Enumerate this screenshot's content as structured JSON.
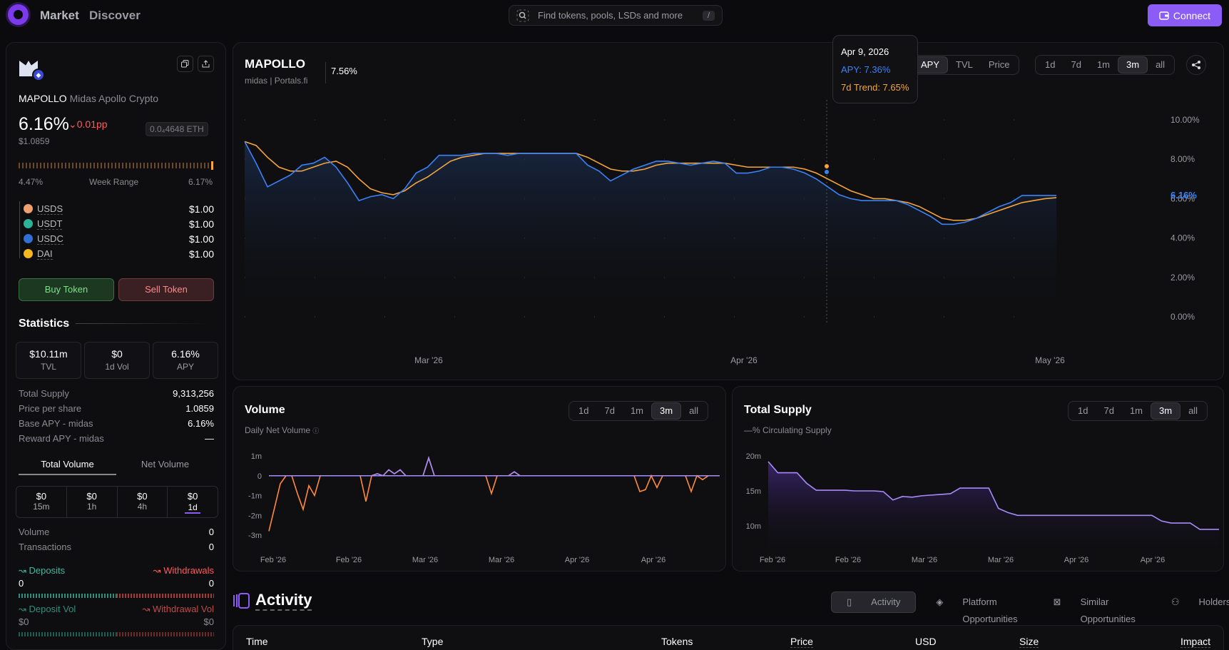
{
  "nav": {
    "brand_items": [
      "Market",
      "Discover"
    ],
    "search_placeholder": "Find tokens, pools, LSDs and more",
    "search_shortcut": "/",
    "connect_label": "Connect"
  },
  "token": {
    "symbol": "MAPOLLO",
    "name": "Midas Apollo Crypto",
    "apy": "6.16%",
    "change": "0.01pp",
    "price": "$1.0859",
    "eth_price": "0.0₄4648 ETH",
    "week_low": "4.47%",
    "week_label": "Week Range",
    "week_high": "6.17%",
    "underlyings": [
      {
        "name": "USDS",
        "value": "$1.00",
        "color": "#f0a070"
      },
      {
        "name": "USDT",
        "value": "$1.00",
        "color": "#2bb39a"
      },
      {
        "name": "USDC",
        "value": "$1.00",
        "color": "#2f6fd6"
      },
      {
        "name": "DAI",
        "value": "$1.00",
        "color": "#f5b71f"
      }
    ],
    "buy_label": "Buy Token",
    "sell_label": "Sell Token"
  },
  "stats": {
    "title": "Statistics",
    "cards": [
      {
        "value": "$10.11m",
        "label": "TVL"
      },
      {
        "value": "$0",
        "label": "1d Vol"
      },
      {
        "value": "6.16%",
        "label": "APY"
      }
    ],
    "rows": [
      {
        "label": "Total Supply",
        "value": "9,313,256"
      },
      {
        "label": "Price per share",
        "value": "1.0859"
      },
      {
        "label": "Base APY - midas",
        "value": "6.16%"
      },
      {
        "label": "Reward APY - midas",
        "value": "—"
      }
    ],
    "vol_tabs": [
      "Total Volume",
      "Net Volume"
    ],
    "periods": [
      {
        "value": "$0",
        "label": "15m"
      },
      {
        "value": "$0",
        "label": "1h"
      },
      {
        "value": "$0",
        "label": "4h"
      },
      {
        "value": "$0",
        "label": "1d"
      }
    ],
    "volume_label": "Volume",
    "volume_value": "0",
    "tx_label": "Transactions",
    "tx_value": "0",
    "deposits_label": "Deposits",
    "withdrawals_label": "Withdrawals",
    "deposits_value": "0",
    "withdrawals_value": "0",
    "deposit_vol_label": "Deposit Vol",
    "withdrawal_vol_label": "Withdrawal Vol",
    "deposit_vol_value": "$0",
    "withdrawal_vol_value": "$0"
  },
  "main_chart": {
    "title": "MAPOLLO",
    "subtitle": "midas | Portals.fi",
    "value": "7.56%",
    "metric_tabs": [
      "APY",
      "TVL",
      "Price"
    ],
    "range_tabs": [
      "1d",
      "7d",
      "1m",
      "3m",
      "all"
    ],
    "tooltip": {
      "date": "Apr 9, 2026",
      "apy": "APY: 7.36%",
      "trend": "7d Trend: 7.65%"
    },
    "current_label": "6.16%",
    "colors": {
      "apy": "#3b82f6",
      "trend": "#f5a53a"
    }
  },
  "volume_chart": {
    "title": "Volume",
    "subtitle": "Daily Net Volume",
    "range_tabs": [
      "1d",
      "7d",
      "1m",
      "3m",
      "all"
    ]
  },
  "supply_chart": {
    "title": "Total Supply",
    "subtitle": "—% Circulating Supply",
    "range_tabs": [
      "1d",
      "7d",
      "1m",
      "3m",
      "all"
    ]
  },
  "chart_data": [
    {
      "type": "line",
      "title": "MAPOLLO",
      "x_labels": [
        "Mar '26",
        "Apr '26",
        "May '26"
      ],
      "y_ticks": [
        "10.00%",
        "8.00%",
        "6.00%",
        "4.00%",
        "2.00%",
        "0.00%"
      ],
      "ylim": [
        0,
        10
      ],
      "series": [
        {
          "name": "APY",
          "values": [
            8.9,
            7.8,
            6.6,
            6.9,
            7.2,
            7.7,
            7.8,
            8.1,
            7.6,
            6.8,
            5.9,
            6.1,
            6.2,
            6.0,
            6.5,
            7.3,
            7.6,
            8.2,
            8.2,
            8.2,
            8.3,
            8.3,
            8.3,
            8.2,
            8.3,
            8.3,
            8.3,
            8.3,
            8.3,
            8.3,
            7.7,
            7.4,
            6.9,
            7.2,
            7.5,
            7.7,
            7.9,
            7.9,
            7.8,
            7.7,
            7.8,
            7.9,
            7.8,
            7.3,
            7.3,
            7.4,
            7.6,
            7.6,
            7.5,
            7.3,
            7.0,
            6.6,
            6.2,
            6.0,
            5.9,
            5.9,
            5.9,
            5.9,
            5.7,
            5.4,
            5.1,
            4.7,
            4.7,
            4.8,
            5.0,
            5.3,
            5.6,
            5.8,
            6.16,
            6.16,
            6.16,
            6.16
          ]
        },
        {
          "name": "7d Trend",
          "values": [
            8.9,
            8.7,
            8.1,
            7.6,
            7.4,
            7.4,
            7.6,
            7.8,
            7.9,
            7.6,
            7.0,
            6.5,
            6.3,
            6.2,
            6.4,
            6.8,
            7.1,
            7.5,
            7.9,
            8.1,
            8.2,
            8.3,
            8.3,
            8.3,
            8.3,
            8.3,
            8.3,
            8.3,
            8.3,
            8.3,
            8.1,
            7.8,
            7.5,
            7.4,
            7.4,
            7.5,
            7.7,
            7.8,
            7.8,
            7.8,
            7.8,
            7.8,
            7.8,
            7.7,
            7.6,
            7.6,
            7.6,
            7.6,
            7.6,
            7.5,
            7.3,
            7.0,
            6.7,
            6.4,
            6.2,
            6.0,
            6.0,
            5.9,
            5.8,
            5.6,
            5.3,
            5.0,
            4.9,
            4.9,
            5.0,
            5.2,
            5.4,
            5.6,
            5.8,
            5.9,
            6.0,
            6.05
          ]
        }
      ]
    },
    {
      "type": "line",
      "title": "Volume",
      "x_labels": [
        "Feb '26",
        "Feb '26",
        "Mar '26",
        "Mar '26",
        "Apr '26",
        "Apr '26"
      ],
      "y_ticks": [
        "1m",
        "0",
        "-1m",
        "-2m",
        "-3m"
      ],
      "ylim": [
        -3,
        1
      ],
      "series": [
        {
          "name": "Daily Net Volume",
          "values": [
            -2.8,
            -1.6,
            -0.4,
            0,
            0,
            -0.9,
            -1.7,
            -0.5,
            -1.0,
            0,
            0,
            0,
            0,
            0,
            0,
            0,
            0,
            -1.3,
            0,
            0.1,
            0,
            0.3,
            0.1,
            0.3,
            0,
            0,
            0,
            0,
            0.9,
            0,
            0,
            0,
            0,
            0,
            0,
            0,
            0,
            0,
            0,
            -0.9,
            0,
            0,
            0,
            0.2,
            0,
            0,
            0,
            0,
            0,
            0,
            0,
            0,
            0,
            0,
            0,
            0,
            0,
            0,
            0,
            0,
            0,
            0,
            0,
            0,
            0,
            -0.8,
            -0.7,
            0,
            -0.6,
            0,
            0,
            0,
            0,
            0,
            -0.8,
            0,
            -0.2,
            0,
            0,
            0
          ]
        }
      ]
    },
    {
      "type": "area",
      "title": "Total Supply",
      "x_labels": [
        "Feb '26",
        "Feb '26",
        "Mar '26",
        "Mar '26",
        "Apr '26",
        "Apr '26"
      ],
      "y_ticks": [
        "20m",
        "15m",
        "10m"
      ],
      "ylim": [
        8,
        21
      ],
      "series": [
        {
          "name": "Total Supply",
          "values": [
            19.2,
            17.6,
            17.6,
            17.6,
            16.1,
            15.1,
            15.1,
            15.1,
            15.1,
            15.0,
            15.0,
            15.0,
            14.9,
            13.7,
            14.2,
            14.1,
            14.3,
            14.4,
            14.5,
            14.6,
            15.4,
            15.4,
            15.4,
            15.4,
            12.5,
            11.9,
            11.5,
            11.5,
            11.5,
            11.5,
            11.5,
            11.5,
            11.5,
            11.5,
            11.5,
            11.5,
            11.5,
            11.5,
            11.5,
            11.5,
            11.5,
            10.7,
            10.4,
            10.4,
            10.4,
            9.5,
            9.5,
            9.5
          ]
        }
      ]
    }
  ],
  "activity": {
    "title": "Activity",
    "tabs": [
      "Activity",
      "Platform Opportunities",
      "Similar Opportunities",
      "Holders"
    ],
    "columns": [
      "Time",
      "Type",
      "Tokens",
      "Price",
      "USD",
      "Size",
      "Impact"
    ]
  }
}
